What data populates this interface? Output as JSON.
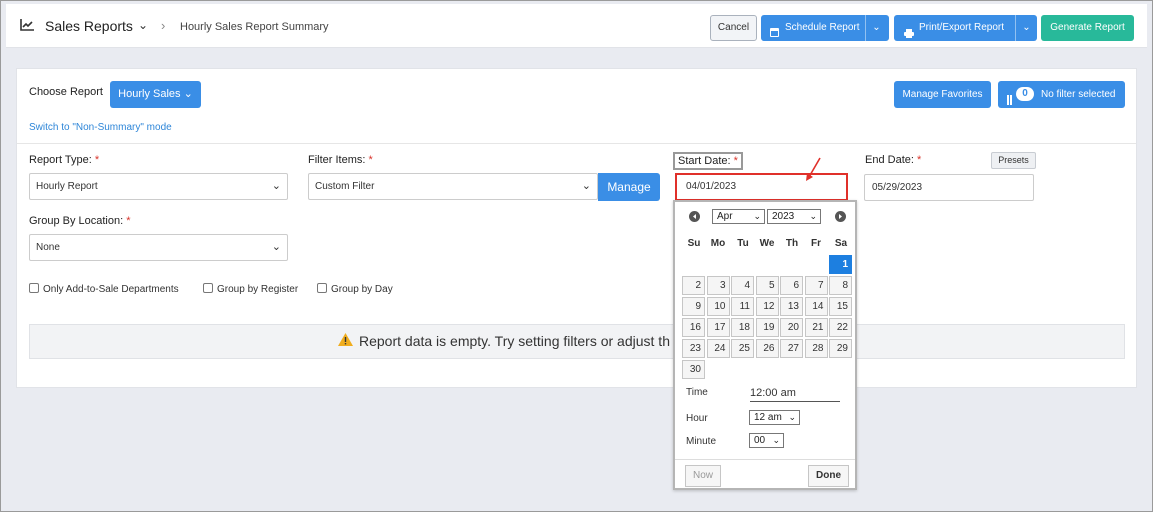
{
  "header": {
    "title": "Sales Reports",
    "breadcrumb": "Hourly Sales Report Summary",
    "cancel": "Cancel",
    "schedule": "Schedule Report",
    "print_export": "Print/Export Report",
    "generate": "Generate Report"
  },
  "choose_report": {
    "label": "Choose Report",
    "value": "Hourly Sales",
    "switch_mode": "Switch to \"Non-Summary\" mode",
    "manage_favorites": "Manage Favorites",
    "filter_count": "0",
    "filter_status": "No filter selected"
  },
  "form": {
    "report_type_label": "Report Type:",
    "report_type_value": "Hourly Report",
    "filter_items_label": "Filter Items:",
    "filter_items_value": "Custom Filter",
    "manage": "Manage",
    "start_date_label": "Start Date:",
    "start_date_value": "04/01/2023",
    "end_date_label": "End Date:",
    "end_date_value": "05/29/2023",
    "presets": "Presets",
    "group_by_location_label": "Group By Location:",
    "group_by_location_value": "None",
    "required_mark": "*",
    "checkboxes": [
      "Only Add-to-Sale Departments",
      "Group by Register",
      "Group by Day"
    ]
  },
  "empty_message": "Report data is empty. Try setting filters or adjust th",
  "datepicker": {
    "month": "Apr",
    "year": "2023",
    "weekdays": [
      "Su",
      "Mo",
      "Tu",
      "We",
      "Th",
      "Fr",
      "Sa"
    ],
    "selected_day": "1",
    "time_label": "Time",
    "time_value": "12:00 am",
    "hour_label": "Hour",
    "hour_value": "12 am",
    "minute_label": "Minute",
    "minute_value": "00",
    "now": "Now",
    "done": "Done"
  },
  "colors": {
    "primary": "#3a8ee6",
    "success": "#28b99a",
    "required": "#d9342b",
    "highlight": "#e0302a",
    "selected_day": "#1d7fe0"
  },
  "icons": [
    "chart-icon",
    "chevron-down-icon",
    "chevron-right-icon",
    "calendar-icon",
    "printer-icon",
    "filter-icon",
    "warning-icon",
    "prev-month-icon",
    "next-month-icon"
  ]
}
